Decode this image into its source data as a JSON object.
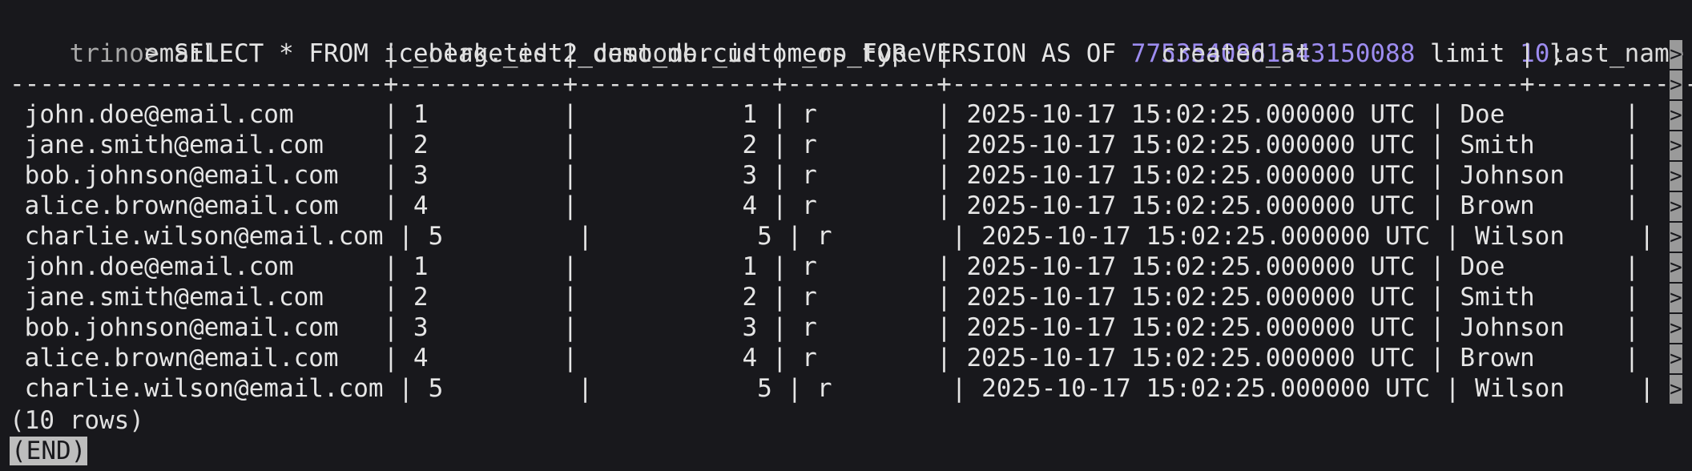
{
  "prompt": {
    "label": "trino>",
    "query_before": " SELECT * FROM iceberg.test2_demo_db.customers FOR VERSION AS OF ",
    "version_id": "7753540861543150088",
    "query_middle": " limit ",
    "limit_value": "10",
    "query_end": ";"
  },
  "table": {
    "header_line": "         email           | _olake_id | customer_id | _op_type |              created_at              | last_name  |",
    "divider_line": "-------------------------+-----------+-------------+----------+--------------------------------------+------------+",
    "rows": [
      " john.doe@email.com      | 1         |           1 | r        | 2025-10-17 15:02:25.000000 UTC | Doe        |",
      " jane.smith@email.com    | 2         |           2 | r        | 2025-10-17 15:02:25.000000 UTC | Smith      |",
      " bob.johnson@email.com   | 3         |           3 | r        | 2025-10-17 15:02:25.000000 UTC | Johnson    |",
      " alice.brown@email.com   | 4         |           4 | r        | 2025-10-17 15:02:25.000000 UTC | Brown      |",
      " charlie.wilson@email.com | 5         |           5 | r        | 2025-10-17 15:02:25.000000 UTC | Wilson     |",
      " john.doe@email.com      | 1         |           1 | r        | 2025-10-17 15:02:25.000000 UTC | Doe        |",
      " jane.smith@email.com    | 2         |           2 | r        | 2025-10-17 15:02:25.000000 UTC | Smith      |",
      " bob.johnson@email.com   | 3         |           3 | r        | 2025-10-17 15:02:25.000000 UTC | Johnson    |",
      " alice.brown@email.com   | 4         |           4 | r        | 2025-10-17 15:02:25.000000 UTC | Brown      |",
      " charlie.wilson@email.com | 5         |           5 | r        | 2025-10-17 15:02:25.000000 UTC | Wilson     |"
    ],
    "overflow_indicator": ">"
  },
  "footer": {
    "row_count": "(10 rows)",
    "end_marker": "(END)"
  },
  "colors": {
    "background": "#18181c",
    "text": "#e6e6e6",
    "prompt": "#a8a8a8",
    "number_literal": "#9d8cf0",
    "end_marker_bg": "#bdbdbd"
  }
}
